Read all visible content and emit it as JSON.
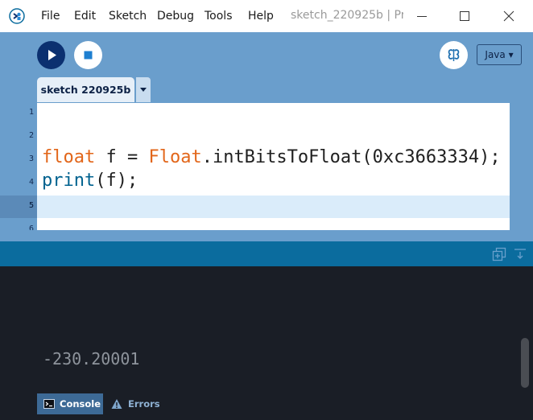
{
  "menu": {
    "items": [
      "File",
      "Edit",
      "Sketch",
      "Debug",
      "Tools",
      "Help"
    ]
  },
  "window": {
    "title": "sketch_220925b | Pro..."
  },
  "toolbar": {
    "mode_label": "Java ▾"
  },
  "tabs": [
    {
      "label": "sketch 220925b"
    }
  ],
  "editor": {
    "line_numbers": [
      "1",
      "2",
      "3",
      "4",
      "5",
      "6"
    ],
    "code": {
      "line3": {
        "kw1": "float",
        "t1": " f = ",
        "kw2": "Float",
        "t2": ".intBitsToFloat(0xc3663334);"
      },
      "line4": {
        "fn": "print",
        "t": "(f);"
      }
    }
  },
  "console": {
    "output": "-230.20001"
  },
  "bottom_tabs": [
    {
      "label": "Console"
    },
    {
      "label": "Errors"
    }
  ],
  "colors": {
    "toolbar_bg": "#6a9ecc",
    "run_button": "#0b3070",
    "console_header": "#0b6c9e",
    "console_bg": "#1a1e26",
    "keyword": "#e2661a",
    "function": "#00628f"
  }
}
